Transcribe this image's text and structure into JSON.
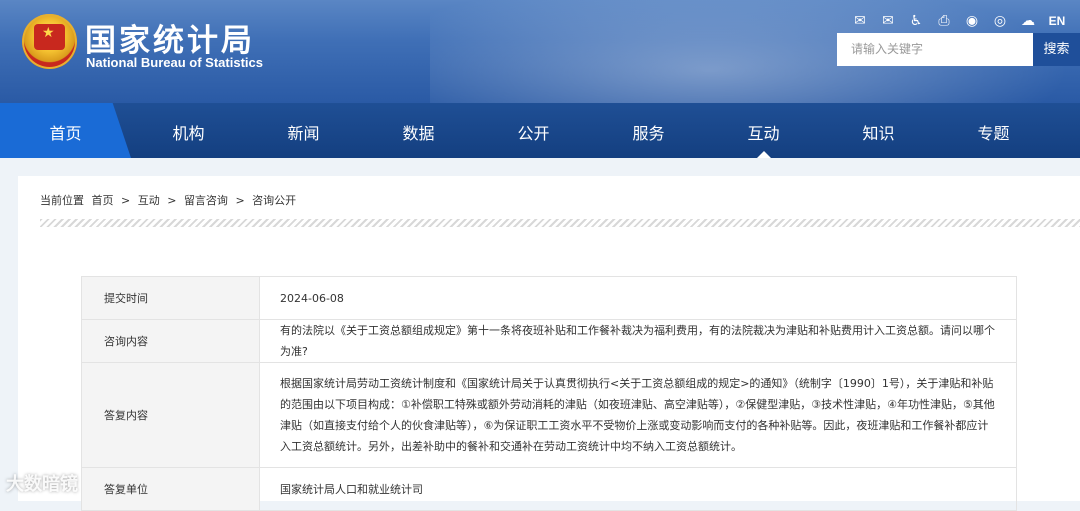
{
  "header": {
    "title_cn": "国家统计局",
    "title_en": "National Bureau of Statistics",
    "icons": [
      "mail-icon",
      "message-icon",
      "accessibility-icon",
      "print-icon",
      "weibo-icon",
      "weibo-alt-icon",
      "wechat-icon"
    ],
    "lang": "EN",
    "search": {
      "placeholder": "请输入关键字",
      "button": "搜索"
    }
  },
  "nav": {
    "items": [
      "首页",
      "机构",
      "新闻",
      "数据",
      "公开",
      "服务",
      "互动",
      "知识",
      "专题"
    ],
    "active": "互动"
  },
  "breadcrumb": [
    "当前位置",
    "首页",
    ">",
    "互动",
    ">",
    "留言咨询",
    ">",
    "咨询公开"
  ],
  "detail": {
    "submit_label": "提交时间",
    "submit_value": "2024-06-08",
    "question_label": "咨询内容",
    "question_value": "有的法院以《关于工资总额组成规定》第十一条将夜班补贴和工作餐补裁决为福利费用，有的法院裁决为津贴和补贴费用计入工资总额。请问以哪个为准?",
    "answer_label": "答复内容",
    "answer_value": "根据国家统计局劳动工资统计制度和《国家统计局关于认真贯彻执行<关于工资总额组成的规定>的通知》（统制字〔1990〕1号），关于津贴和补贴的范围由以下项目构成：①补偿职工特殊或额外劳动消耗的津贴（如夜班津贴、高空津贴等），②保健型津贴，③技术性津贴，④年功性津贴，⑤其他津贴（如直接支付给个人的伙食津贴等），⑥为保证职工工资水平不受物价上涨或变动影响而支付的各种补贴等。因此，夜班津贴和工作餐补都应计入工资总额统计。另外，出差补助中的餐补和交通补在劳动工资统计中均不纳入工资总额统计。",
    "unit_label": "答复单位",
    "unit_value": "国家统计局人口和就业统计司"
  },
  "watermark": "大数暗镜"
}
